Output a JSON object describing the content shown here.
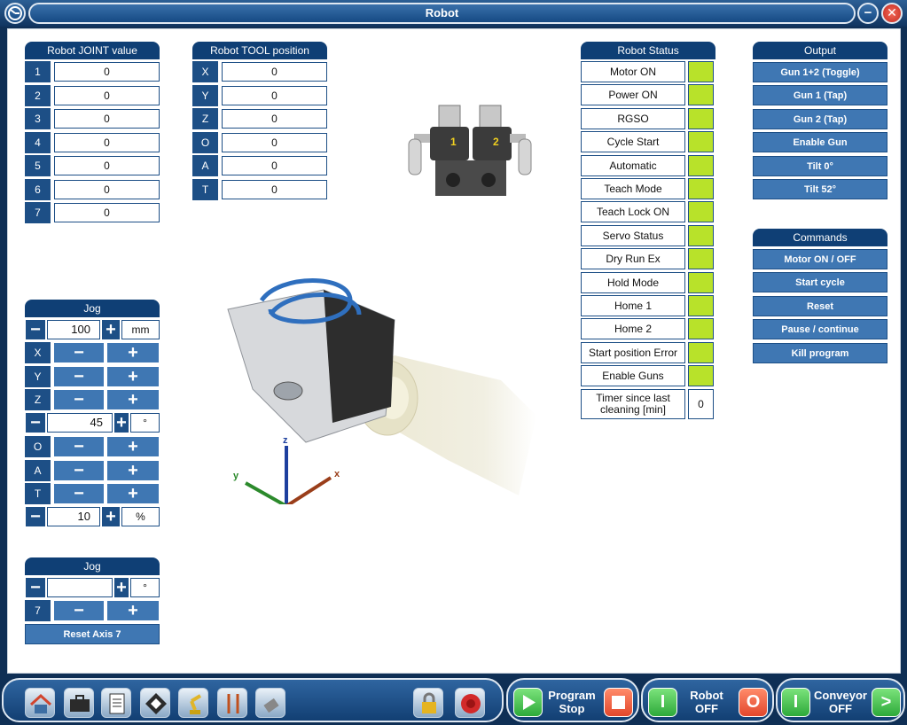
{
  "window": {
    "title": "Robot",
    "close_glyph": "✕",
    "minimize_glyph": "−"
  },
  "joint": {
    "title": "Robot JOINT value",
    "rows": [
      {
        "label": "1",
        "value": "0"
      },
      {
        "label": "2",
        "value": "0"
      },
      {
        "label": "3",
        "value": "0"
      },
      {
        "label": "4",
        "value": "0"
      },
      {
        "label": "5",
        "value": "0"
      },
      {
        "label": "6",
        "value": "0"
      },
      {
        "label": "7",
        "value": "0"
      }
    ]
  },
  "tool": {
    "title": "Robot TOOL position",
    "rows": [
      {
        "label": "X",
        "value": "0"
      },
      {
        "label": "Y",
        "value": "0"
      },
      {
        "label": "Z",
        "value": "0"
      },
      {
        "label": "O",
        "value": "0"
      },
      {
        "label": "A",
        "value": "0"
      },
      {
        "label": "T",
        "value": "0"
      }
    ]
  },
  "status": {
    "title": "Robot Status",
    "items": [
      "Motor ON",
      "Power ON",
      "RGSO",
      "Cycle Start",
      "Automatic",
      "Teach Mode",
      "Teach Lock ON",
      "Servo Status",
      "Dry Run Ex",
      "Hold Mode",
      "Home 1",
      "Home 2",
      "Start position Error",
      "Enable Guns"
    ],
    "timer_label": "Timer since last cleaning [min]",
    "timer_value": "0",
    "indicator_color": "#b8e22a"
  },
  "output": {
    "title": "Output",
    "buttons": [
      "Gun 1+2 (Toggle)",
      "Gun 1 (Tap)",
      "Gun 2 (Tap)",
      "Enable Gun",
      "Tilt 0°",
      "Tilt 52°"
    ]
  },
  "commands": {
    "title": "Commands",
    "buttons": [
      "Motor ON / OFF",
      "Start cycle",
      "Reset",
      "Pause / continue",
      "Kill program"
    ]
  },
  "jog": {
    "title": "Jog",
    "linear_step": "100",
    "linear_unit": "mm",
    "angular_step": "45",
    "angular_unit": "°",
    "speed": "10",
    "speed_unit": "%",
    "linear_axes": [
      "X",
      "Y",
      "Z"
    ],
    "angular_axes": [
      "O",
      "A",
      "T"
    ],
    "minus": "−",
    "plus": "+"
  },
  "jog2": {
    "title": "Jog",
    "step": "",
    "unit": "°",
    "axis": "7",
    "reset_label": "Reset Axis 7"
  },
  "gun_labels": {
    "gun1": "1",
    "gun2": "2"
  },
  "axes_labels": {
    "x": "x",
    "y": "y",
    "z": "z"
  },
  "bottom": {
    "program": {
      "label": "Program Stop"
    },
    "robot": {
      "label": "Robot OFF",
      "on": "I",
      "off": "O"
    },
    "conveyor": {
      "label": "Conveyor OFF",
      "on": "I",
      "next": ">"
    }
  }
}
